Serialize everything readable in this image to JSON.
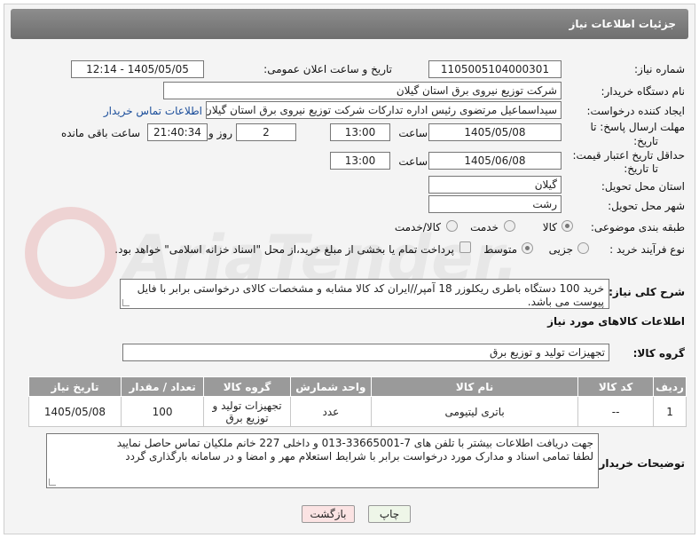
{
  "header": {
    "title": "جزئیات اطلاعات نیاز"
  },
  "need_number": {
    "label": "شماره نیاز:",
    "value": "1105005104000301"
  },
  "announce": {
    "label": "تاریخ و ساعت اعلان عمومی:",
    "value": "1405/05/05 - 12:14"
  },
  "buyer_org": {
    "label": "نام دستگاه خریدار:",
    "value": "شرکت توزیع نیروی برق استان گیلان"
  },
  "requester": {
    "label": "ایجاد کننده درخواست:",
    "value": "سیداسماعیل مرتضوی رئیس اداره تدارکات شرکت توزیع نیروی برق استان گیلان",
    "contact_link": "اطلاعات تماس خریدار"
  },
  "reply_deadline": {
    "label1": "مهلت ارسال پاسخ: تا",
    "label2": "تاریخ:",
    "date": "1405/05/08",
    "time_label": "ساعت",
    "time": "13:00",
    "days": "2",
    "days_label": "روز و",
    "remaining": "21:40:34",
    "remaining_label": "ساعت باقی مانده"
  },
  "price_validity": {
    "label1": "حداقل تاریخ اعتبار قیمت:",
    "label2": "تا تاریخ:",
    "date": "1405/06/08",
    "time_label": "ساعت",
    "time": "13:00"
  },
  "province": {
    "label": "استان محل تحویل:",
    "value": "گیلان"
  },
  "city": {
    "label": "شهر محل تحویل:",
    "value": "رشت"
  },
  "category": {
    "label": "طبقه بندی موضوعی:",
    "options": [
      "کالا",
      "خدمت",
      "کالا/خدمت"
    ],
    "selected": "کالا"
  },
  "purchase_type": {
    "label": "نوع فرآیند خرید :",
    "options": [
      "جزیی",
      "متوسط"
    ],
    "selected": "متوسط",
    "payment_note": "پرداخت تمام یا بخشی از مبلغ خرید،از محل \"اسناد خزانه اسلامی\" خواهد بود."
  },
  "description": {
    "label": "شرح کلی نیاز:",
    "value": "خرید 100 دستگاه باطری ریکلوزر 18 آمپر//ایران کد کالا مشابه و مشخصات کالای درخواستی برابر با فایل پیوست می باشد."
  },
  "goods_info": {
    "title": "اطلاعات کالاهای مورد نیاز"
  },
  "goods_group": {
    "label": "گروه کالا:",
    "value": "تجهیزات تولید و توزیع برق"
  },
  "table": {
    "headers": [
      "ردیف",
      "کد کالا",
      "نام کالا",
      "واحد شمارش",
      "گروه کالا",
      "تعداد / مقدار",
      "تاریخ نیاز"
    ],
    "rows": [
      [
        "1",
        "--",
        "باتری لیتیومی",
        "عدد",
        "تجهیزات تولید و توزیع برق",
        "100",
        "1405/05/08"
      ]
    ]
  },
  "buyer_notes": {
    "label": "توضیحات خریدار:",
    "line1": "جهت دریافت اطلاعات بیشتر با تلفن های 7-33665001-013 و داخلی 227 خانم ملکیان تماس حاصل نمایید",
    "line2": "لطفا تمامی اسناد و مدارک مورد درخواست برابر با شرایط استعلام مهر و امضا و در سامانه بارگذاری گردد"
  },
  "buttons": {
    "print": "چاپ",
    "back": "بازگشت"
  },
  "watermark": {
    "text": "AriaTender.net"
  }
}
